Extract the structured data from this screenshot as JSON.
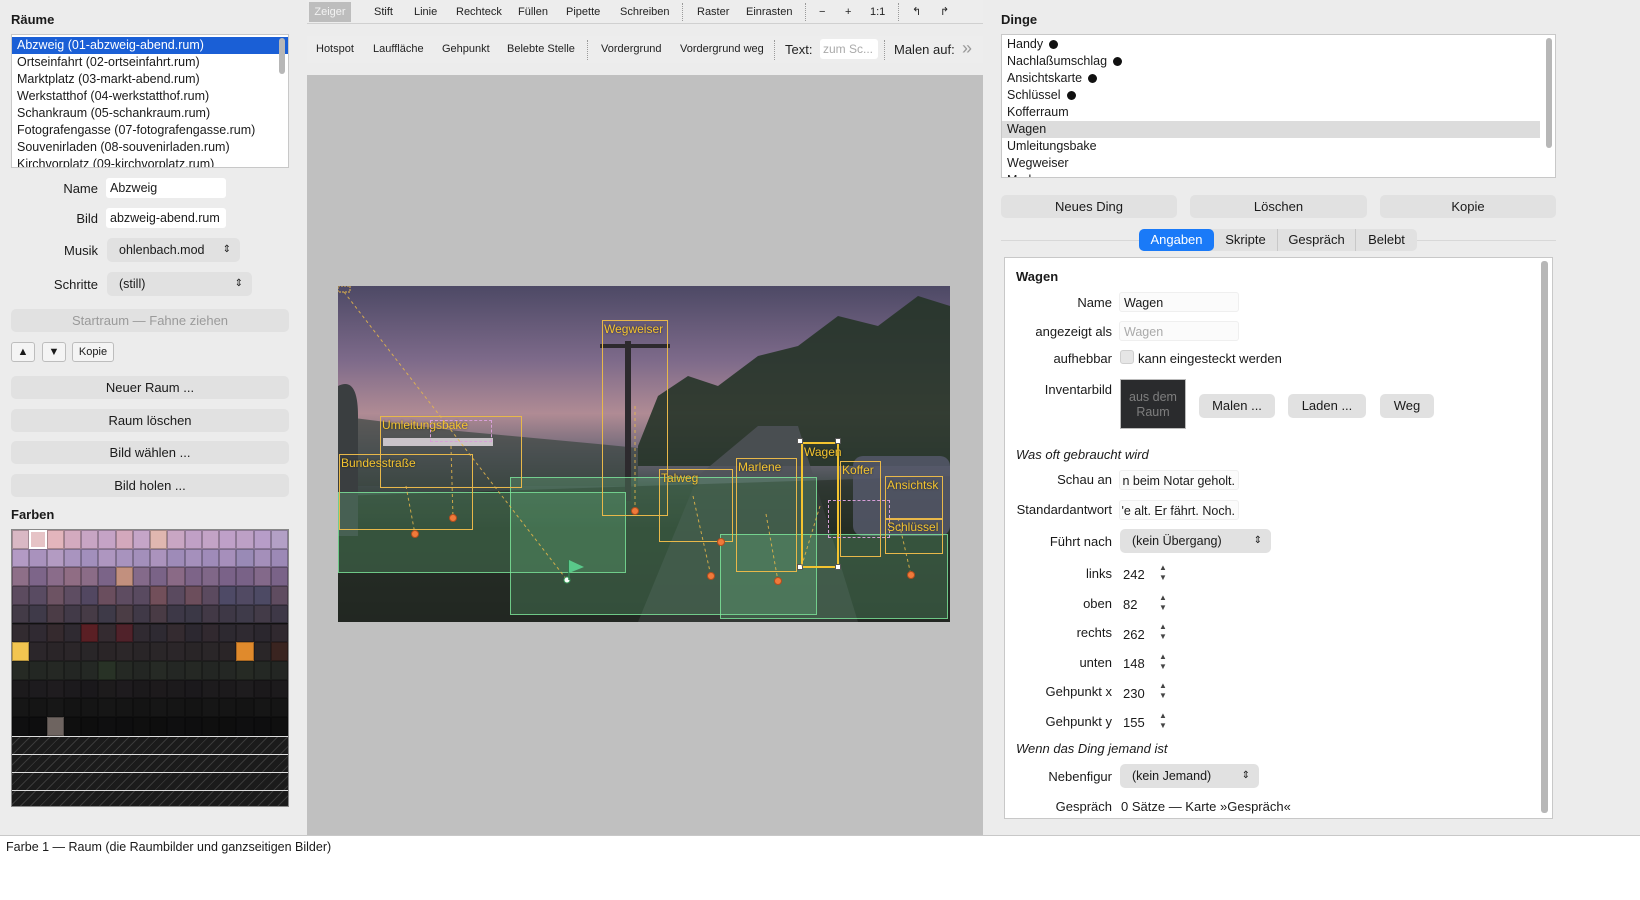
{
  "rooms": {
    "title": "Räume",
    "items": [
      {
        "label": "Abzweig  (01-abzweig-abend.rum)"
      },
      {
        "label": "Ortseinfahrt  (02-ortseinfahrt.rum)"
      },
      {
        "label": "Marktplatz  (03-markt-abend.rum)"
      },
      {
        "label": "Werkstatthof  (04-werkstatthof.rum)"
      },
      {
        "label": "Schankraum  (05-schankraum.rum)"
      },
      {
        "label": "Fotografengasse  (07-fotografengasse.rum)"
      },
      {
        "label": "Souvenirladen  (08-souvenirladen.rum)"
      },
      {
        "label": "Kirchvorplatz  (09-kirchvorplatz.rum)"
      }
    ],
    "selected_index": 0
  },
  "room_props": {
    "name_label": "Name",
    "name_value": "Abzweig",
    "bild_label": "Bild",
    "bild_value": "abzweig-abend.rum",
    "musik_label": "Musik",
    "musik_value": "ohlenbach.mod",
    "schritte_label": "Schritte",
    "schritte_value": "(still)",
    "startraum_label": "Startraum — Fahne ziehen",
    "up_label": "▲",
    "down_label": "▼",
    "copy_label": "Kopie",
    "new_room": "Neuer Raum ...",
    "delete_room": "Raum löschen",
    "choose_image": "Bild wählen ...",
    "fetch_image": "Bild holen ..."
  },
  "colors": {
    "title": "Farben",
    "status": "Farbe 1 — Raum (die Raumbilder und ganzseitigen Bilder)",
    "palette_rows": [
      [
        "#d9b8c4",
        "#e6c3c6",
        "#e3b5bc",
        "#d3aabf",
        "#c8a5c4",
        "#c5a3c6",
        "#d3a8bc",
        "#c5a5c8",
        "#e0b7b0",
        "#c9a6c3",
        "#c0a0c6",
        "#c3a3c6",
        "#bfa0c8",
        "#bda0c6",
        "#b79dc8",
        "#b3a0c6"
      ],
      [
        "#b39ac4",
        "#a992bd",
        "#b39bc2",
        "#a994bf",
        "#a28fbc",
        "#ae96c0",
        "#a893be",
        "#a38fbb",
        "#ab93bd",
        "#9e8bb8",
        "#a590bc",
        "#9f8bb9",
        "#a68fbb",
        "#998ab6",
        "#a48fba",
        "#9c89b6"
      ],
      [
        "#8e6f88",
        "#7d6589",
        "#8a6c8a",
        "#906d84",
        "#8b6c87",
        "#7b6488",
        "#c2907e",
        "#846a8a",
        "#7a6387",
        "#8a6a86",
        "#7d6488",
        "#806788",
        "#7a6288",
        "#796287",
        "#83698a",
        "#7a6388"
      ],
      [
        "#5c4b5f",
        "#594b62",
        "#6d5363",
        "#5e4d62",
        "#524761",
        "#6a4e5e",
        "#5e4c61",
        "#594a60",
        "#724f5a",
        "#5a4a5f",
        "#6c4e5c",
        "#5b4a5f",
        "#4e4a66",
        "#514a63",
        "#4d4a64",
        "#5f4c60"
      ],
      [
        "#433b47",
        "#3f3a49",
        "#4b3c46",
        "#423a48",
        "#463b46",
        "#3e3a48",
        "#4b3d45",
        "#403947",
        "#493b45",
        "#3d3847",
        "#3b3846",
        "#423946",
        "#3e3846",
        "#3f3b4a",
        "#433b48",
        "#3e3847"
      ],
      [
        "#322b30",
        "#302a32",
        "#352a2e",
        "#2f2a31",
        "#5a1f24",
        "#342b30",
        "#50222a",
        "#302a31",
        "#2e2a32",
        "#342b30",
        "#2c2830",
        "#31292f",
        "#2d2930",
        "#2f2a31",
        "#2b272e",
        "#30292f"
      ],
      [
        "#f2c550",
        "#2b262a",
        "#2a2528",
        "#2b2629",
        "#292628",
        "#2a2527",
        "#2c2729",
        "#292527",
        "#2a2628",
        "#2b2629",
        "#292527",
        "#2a2628",
        "#2a2527",
        "#e08a2c",
        "#2a2628",
        "#3a2420"
      ],
      [
        "#262a24",
        "#232723",
        "#252824",
        "#232623",
        "#242824",
        "#283226",
        "#252924",
        "#232623",
        "#262a25",
        "#242724",
        "#252824",
        "#232623",
        "#242724",
        "#262a24",
        "#242824",
        "#232623"
      ],
      [
        "#1c1a1c",
        "#1d1b1e",
        "#1f1c1f",
        "#1c1a1d",
        "#1a181b",
        "#1d1b1c",
        "#1e1b1e",
        "#1b191b",
        "#1d1a1c",
        "#1c1a1c",
        "#1b191c",
        "#1d1b1d",
        "#1c1a1c",
        "#1e1c1e",
        "#1b191b",
        "#1c1a1c"
      ],
      [
        "#161616",
        "#151515",
        "#171717",
        "#141414",
        "#151515",
        "#161616",
        "#151515",
        "#141414",
        "#161616",
        "#151515",
        "#141414",
        "#161616",
        "#151515",
        "#141414",
        "#161616",
        "#151515"
      ],
      [
        "#0f0f10",
        "#0e0e0f",
        "#6e6460",
        "#0f0f0f",
        "#0e0e0e",
        "#0f0f10",
        "#0e0e0f",
        "#0f0f0f",
        "#0e0e0e",
        "#0f0f10",
        "#0e0e0f",
        "#0f0f0f",
        "#0e0e0e",
        "#0f0f10",
        "#0e0e0f",
        "#0f0f0f"
      ]
    ]
  },
  "toolbar1": {
    "items": [
      "Zeiger",
      "Stift",
      "Linie",
      "Rechteck",
      "Füllen",
      "Pipette",
      "Schreiben",
      "Raster",
      "Einrasten",
      "−",
      "+",
      "1:1",
      "↰",
      "↱"
    ]
  },
  "toolbar2": {
    "items": [
      "Hotspot",
      "Lauffläche",
      "Gehpunkt",
      "Belebte Stelle",
      "Vordergrund",
      "Vordergrund weg"
    ],
    "text_label": "Text:",
    "text_placeholder": "zum Sc...",
    "paint_label": "Malen auf:",
    "more": "»"
  },
  "scene": {
    "hotspots": [
      "Wegweiser",
      "Umleitungsbake",
      "Bundesstraße",
      "Talweg",
      "Marlene",
      "Wagen",
      "Koffer",
      "Ansichtsk",
      "Schlüssel"
    ]
  },
  "things": {
    "title": "Dinge",
    "items": [
      {
        "label": "Handy",
        "carried": true
      },
      {
        "label": "Nachlaßumschlag",
        "carried": true
      },
      {
        "label": "Ansichtskarte",
        "carried": true
      },
      {
        "label": "Schlüssel",
        "carried": true
      },
      {
        "label": "Kofferraum",
        "carried": false
      },
      {
        "label": "Wagen",
        "carried": false
      },
      {
        "label": "Umleitungsbake",
        "carried": false
      },
      {
        "label": "Wegweiser",
        "carried": false
      },
      {
        "label": "Marlene",
        "carried": false
      }
    ],
    "selected_index": 5,
    "new_thing": "Neues Ding",
    "delete": "Löschen",
    "copy": "Kopie",
    "tabs": [
      "Angaben",
      "Skripte",
      "Gespräch",
      "Belebt"
    ],
    "active_tab": 0
  },
  "detail": {
    "heading": "Wagen",
    "name_label": "Name",
    "name_value": "Wagen",
    "shown_label": "angezeigt als",
    "shown_placeholder": "Wagen",
    "takeable_label": "aufhebbar",
    "takeable_text": "kann eingesteckt werden",
    "inv_label": "Inventarbild",
    "inv_preview": "aus dem Raum",
    "paint_btn": "Malen ...",
    "load_btn": "Laden ...",
    "remove_btn": "Weg",
    "section_used": "Was oft gebraucht wird",
    "look_label": "Schau an",
    "look_value": "n beim Notar geholt.",
    "default_label": "Standardantwort",
    "default_value": "'e alt. Er fährt. Noch.",
    "leads_label": "Führt nach",
    "leads_value": "(kein Übergang)",
    "left_label": "links",
    "left_value": "242",
    "top_label": "oben",
    "top_value": "82",
    "right_label": "rechts",
    "right_value": "262",
    "bottom_label": "unten",
    "bottom_value": "148",
    "walkx_label": "Gehpunkt x",
    "walkx_value": "230",
    "walky_label": "Gehpunkt y",
    "walky_value": "155",
    "section_person": "Wenn das Ding jemand ist",
    "npc_label": "Nebenfigur",
    "npc_value": "(kein Jemand)",
    "talk_label": "Gespräch",
    "talk_value": "0 Sätze — Karte »Gespräch«"
  },
  "accent": "#1a7af8"
}
